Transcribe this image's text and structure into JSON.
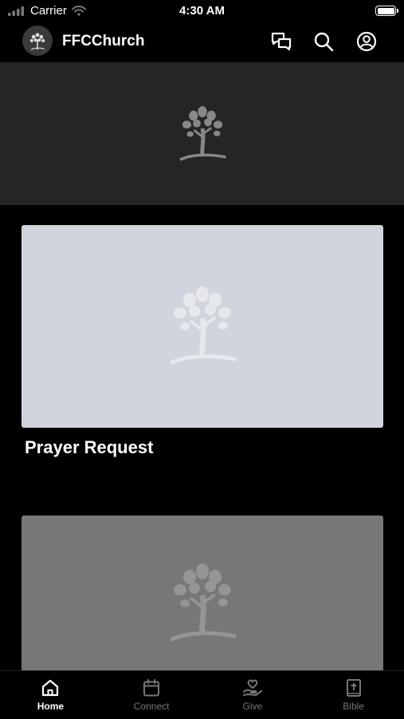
{
  "status_bar": {
    "carrier": "Carrier",
    "time": "4:30 AM"
  },
  "header": {
    "app_name": "FFCChurch",
    "actions": [
      "chat-bubbles-icon",
      "search-icon",
      "profile-icon"
    ]
  },
  "cards": [
    {
      "title": "Prayer Request"
    }
  ],
  "tabs": [
    {
      "label": "Home",
      "icon": "home-icon",
      "active": true
    },
    {
      "label": "Connect",
      "icon": "calendar-icon",
      "active": false
    },
    {
      "label": "Give",
      "icon": "give-hand-heart-icon",
      "active": false
    },
    {
      "label": "Bible",
      "icon": "bible-icon",
      "active": false
    }
  ],
  "colors": {
    "background": "#000000",
    "hero": "#252525",
    "card1": "#d0d4dc",
    "card2": "#777775",
    "tab_active": "#ffffff",
    "tab_inactive": "#777777"
  }
}
